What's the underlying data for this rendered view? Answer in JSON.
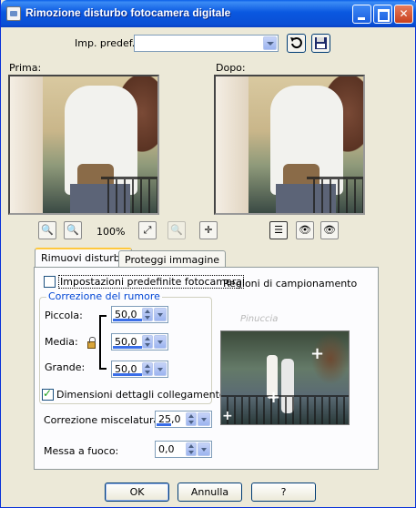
{
  "window": {
    "title": "Rimozione disturbo fotocamera digitale"
  },
  "preset": {
    "label": "Imp. predef.:",
    "value": ""
  },
  "previews": {
    "before_label": "Prima:",
    "after_label": "Dopo:"
  },
  "zoom": {
    "value": "100%"
  },
  "tabs": [
    {
      "label": "Rimuovi disturbo",
      "active": true
    },
    {
      "label": "Proteggi immagine",
      "active": false
    }
  ],
  "remove_noise": {
    "camera_defaults_label": "Impostazioni predefinite fotocamera",
    "camera_defaults_checked": false,
    "noise_group_title": "Correzione del rumore",
    "small_label": "Piccola:",
    "small_value": "50,0",
    "medium_label": "Media:",
    "medium_value": "50,0",
    "large_label": "Grande:",
    "large_value": "50,0",
    "link_label": "Dimensioni dettagli collegamento",
    "link_checked": true,
    "blend_label": "Correzione miscelatura:",
    "blend_value": "25,0",
    "sharpen_label": "Messa a fuoco:",
    "sharpen_value": "0,0",
    "sampling_label": "Regioni di campionamento",
    "watermark": "Pinuccia"
  },
  "buttons": {
    "ok": "OK",
    "cancel": "Annulla",
    "help": "?"
  }
}
